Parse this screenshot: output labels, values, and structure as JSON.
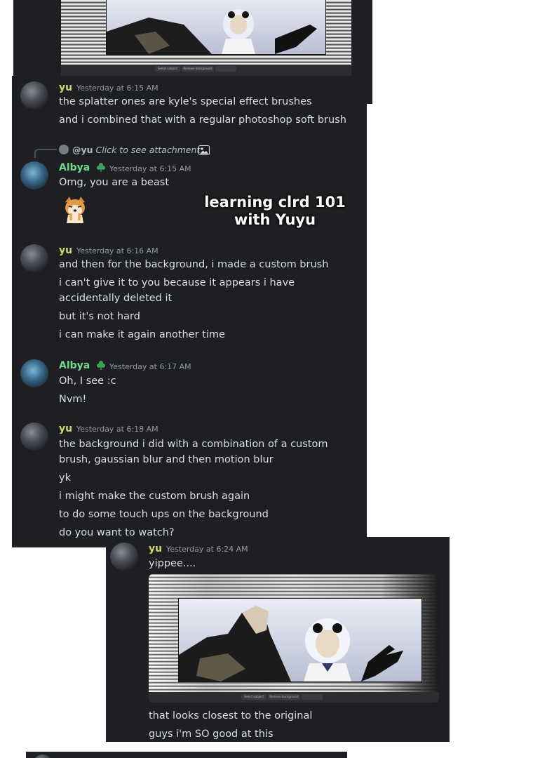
{
  "top_bar": {
    "btn1": "Select subject",
    "btn2": "Remove background"
  },
  "messages": [
    {
      "author": "yu",
      "time": "Yesterday at 6:15 AM",
      "lines": [
        "the splatter ones are kyle's special effect brushes",
        "and i combined that with a regular photoshop soft brush"
      ]
    },
    {
      "reply_to": "@yu",
      "reply_text": "Click to see attachment",
      "author": "Albya",
      "time": "Yesterday at 6:15 AM",
      "lines": [
        "Omg, you are a beast"
      ]
    },
    {
      "author": "yu",
      "time": "Yesterday at 6:16 AM",
      "lines": [
        "and then for the background, i made a custom brush",
        "i can't give it to you because it appears i have accidentally deleted it",
        "but it's not hard",
        "i can make it again another time"
      ]
    },
    {
      "author": "Albya",
      "time": "Yesterday at 6:17 AM",
      "lines": [
        "Oh, I see :c",
        "Nvm!"
      ]
    },
    {
      "author": "yu",
      "time": "Yesterday at 6:18 AM",
      "lines": [
        "the background i did with a combination of a custom brush, gaussian blur and then motion blur",
        "yk",
        "i might make the custom brush again",
        "to do some touch ups on the background",
        "do you want to watch?"
      ]
    },
    {
      "author": "yu",
      "time": "Yesterday at 6:24 AM",
      "lines": [
        "yippee....",
        "that looks closest to the original",
        "guys i'm SO good at this"
      ]
    }
  ],
  "overlay": {
    "line1": "learning clrd 101",
    "line2": "with Yuyu"
  },
  "colors": {
    "panel_bg": "#1e1f22",
    "yu_name": "#d9d56b",
    "albya_name": "#6fdc8c",
    "timestamp": "#949ba4",
    "text": "#dbdee1"
  }
}
